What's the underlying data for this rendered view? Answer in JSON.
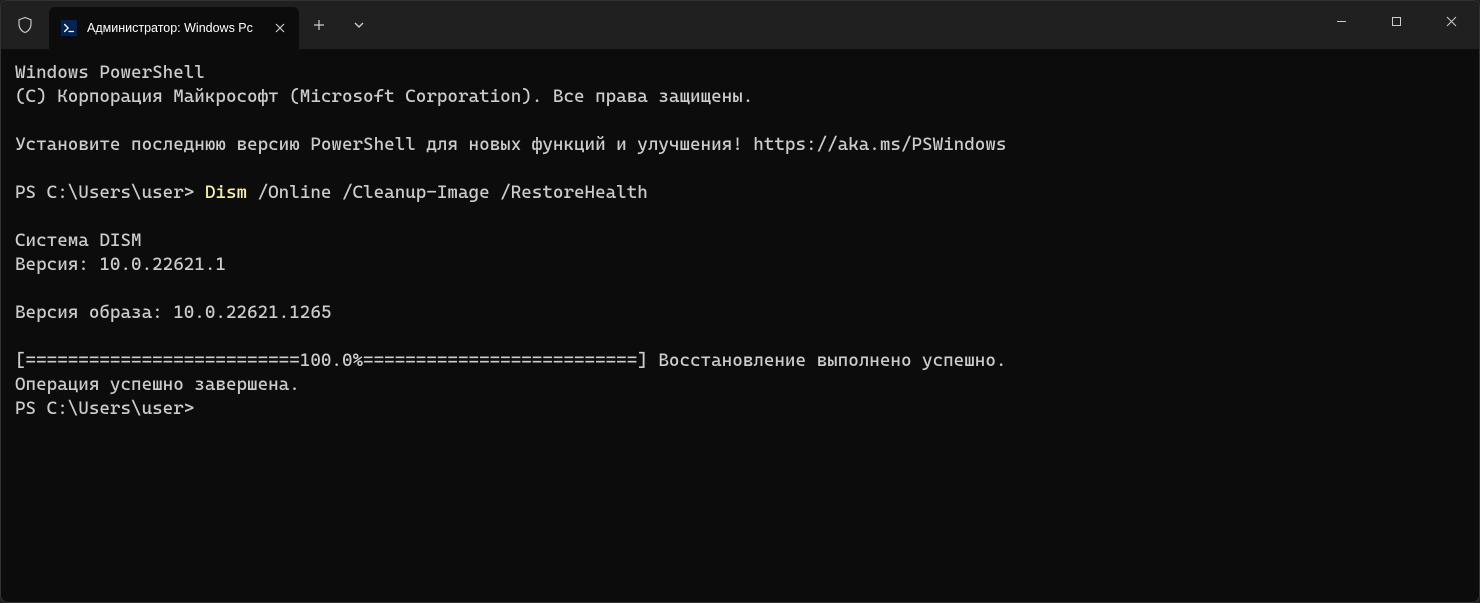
{
  "tab": {
    "title": "Администратор: Windows Pc"
  },
  "terminal": {
    "line1": "Windows PowerShell",
    "line2": "(C) Корпорация Майкрософт (Microsoft Corporation). Все права защищены.",
    "blank1": "",
    "line3": "Установите последнюю версию PowerShell для новых функций и улучшения! https://aka.ms/PSWindows",
    "blank2": "",
    "prompt1_prefix": "PS C:\\Users\\user> ",
    "prompt1_cmd": "Dism",
    "prompt1_args": " /Online /Cleanup-Image /RestoreHealth",
    "blank3": "",
    "line4": "Система DISM",
    "line5": "Версия: 10.0.22621.1",
    "blank4": "",
    "line6": "Версия образа: 10.0.22621.1265",
    "blank5": "",
    "line7": "[==========================100.0%==========================] Восстановление выполнено успешно.",
    "line8": "Операция успешно завершена.",
    "prompt2": "PS C:\\Users\\user>"
  }
}
